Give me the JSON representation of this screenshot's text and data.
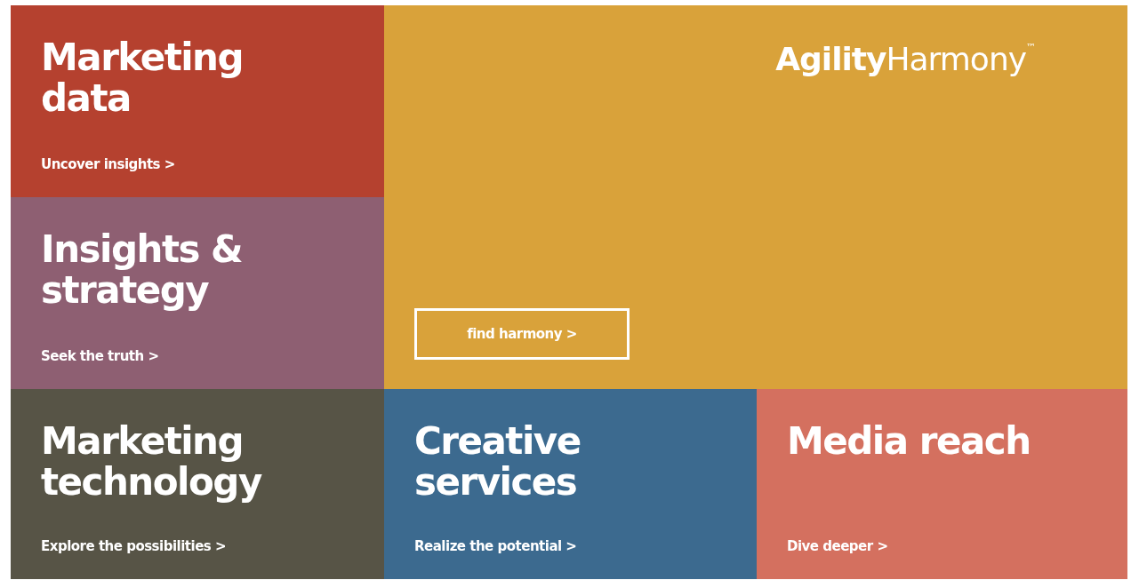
{
  "tiles": [
    {
      "kind": "service",
      "title": "Marketing data",
      "link": "Uncover insights >",
      "color": "#b5412f"
    },
    {
      "kind": "feature",
      "logo": "**Agility**Harmony$^{™}$",
      "button": "find harmony >",
      "color": "#d9a23a"
    },
    {
      "kind": "service",
      "title": "Insights & strategy",
      "link": "Seek the truth >",
      "color": "#8e5f72"
    },
    {
      "kind": "service",
      "title": "Marketing technology",
      "link": "Explore the possibilities >",
      "color": "#575446"
    },
    {
      "kind": "service",
      "title": "Creative services",
      "link": "Realize the potential >",
      "color": "#3c6a8f"
    },
    {
      "kind": "service",
      "title": "Media reach",
      "link": "Dive deeper >",
      "color": "#d4705f"
    }
  ]
}
